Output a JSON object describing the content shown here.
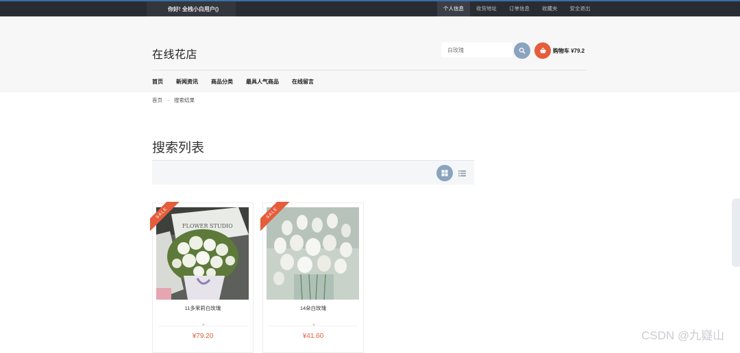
{
  "topbar": {
    "greeting": "你好!  全栈小白用户()",
    "links": [
      "个人信息",
      "收货地址",
      "订单信息",
      "收藏夹",
      "安全退出"
    ]
  },
  "header": {
    "logo": "在线花店",
    "search": {
      "value": "白玫瑰"
    },
    "cart_label": "购物车 ¥79.2",
    "accent_color": "#e55d3b",
    "button_color": "#8aa3bf"
  },
  "nav": {
    "items": [
      "首页",
      "新闻资讯",
      "商品分类",
      "最具人气商品",
      "在线留言"
    ]
  },
  "breadcrumb": {
    "home": "首页",
    "separator": "→",
    "current": "搜索结果"
  },
  "main": {
    "title": "搜索列表",
    "view_icons": [
      "grid-icon",
      "list-icon"
    ],
    "products": [
      {
        "name": "11多茉莉白玫瑰",
        "price": "¥79.20",
        "badge": "SALE"
      },
      {
        "name": "14朵白玫瑰",
        "price": "¥41.60",
        "badge": "SALE"
      }
    ]
  },
  "watermark": "CSDN @九嶷山"
}
